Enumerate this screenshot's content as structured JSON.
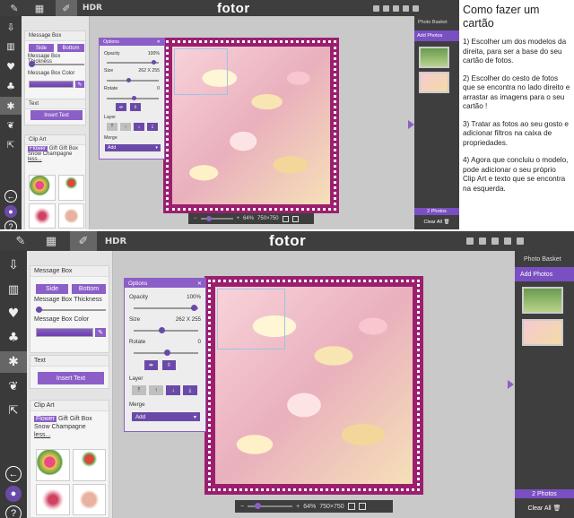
{
  "topbar": {
    "hdr_label": "HDR",
    "logo": "fotor"
  },
  "left_toolbar": {
    "icons": [
      "download-icon",
      "collage-icon",
      "heart-icon",
      "tree-icon",
      "star-icon",
      "card-icon",
      "share-icon"
    ]
  },
  "props": {
    "message_box_title": "Message Box",
    "side_label": "Side",
    "bottom_label": "Bottom",
    "thickness_label": "Message Box Thickness",
    "color_label": "Message Box Color",
    "text_title": "Text",
    "insert_text_label": "Insert Text",
    "clipart_title": "Clip Art",
    "categories": [
      "Flower",
      "Gift",
      "Gift Box",
      "Snow",
      "Champagne"
    ],
    "less_label": "less...",
    "thickness_value": 0.25
  },
  "options": {
    "title": "Options",
    "opacity_label": "Opacity",
    "opacity_value": "100%",
    "size_label": "Size",
    "size_value": "262 X 255",
    "rotate_label": "Rotate",
    "rotate_value": "0",
    "layer_label": "Layer",
    "merge_label": "Merge",
    "add_label": "Add"
  },
  "zoom": {
    "percent": "64%",
    "dimensions": "750×750"
  },
  "basket": {
    "title": "Photo Basket",
    "add_photos": "Add Photos",
    "count": "2 Photos",
    "clear_all": "Clear All"
  },
  "tutorial": {
    "title": "Como fazer um cartão",
    "steps": [
      "1) Escolher um dos modelos da direita, para ser a base do seu cartão de fotos.",
      "2) Escolher do cesto de fotos que se encontra no lado direito e arrastar as imagens para o seu cartão !",
      "3) Tratar as fotos ao seu gosto e adicionar filtros na caixa de propriedades.",
      "4) Agora que concluiu o modelo, pode adicionar o seu próprio Clip Art e texto que se encontra na esquerda."
    ]
  },
  "colors": {
    "accent": "#8b5fc7",
    "frame": "#9b1f6e",
    "topbar": "#3e3e3e"
  }
}
